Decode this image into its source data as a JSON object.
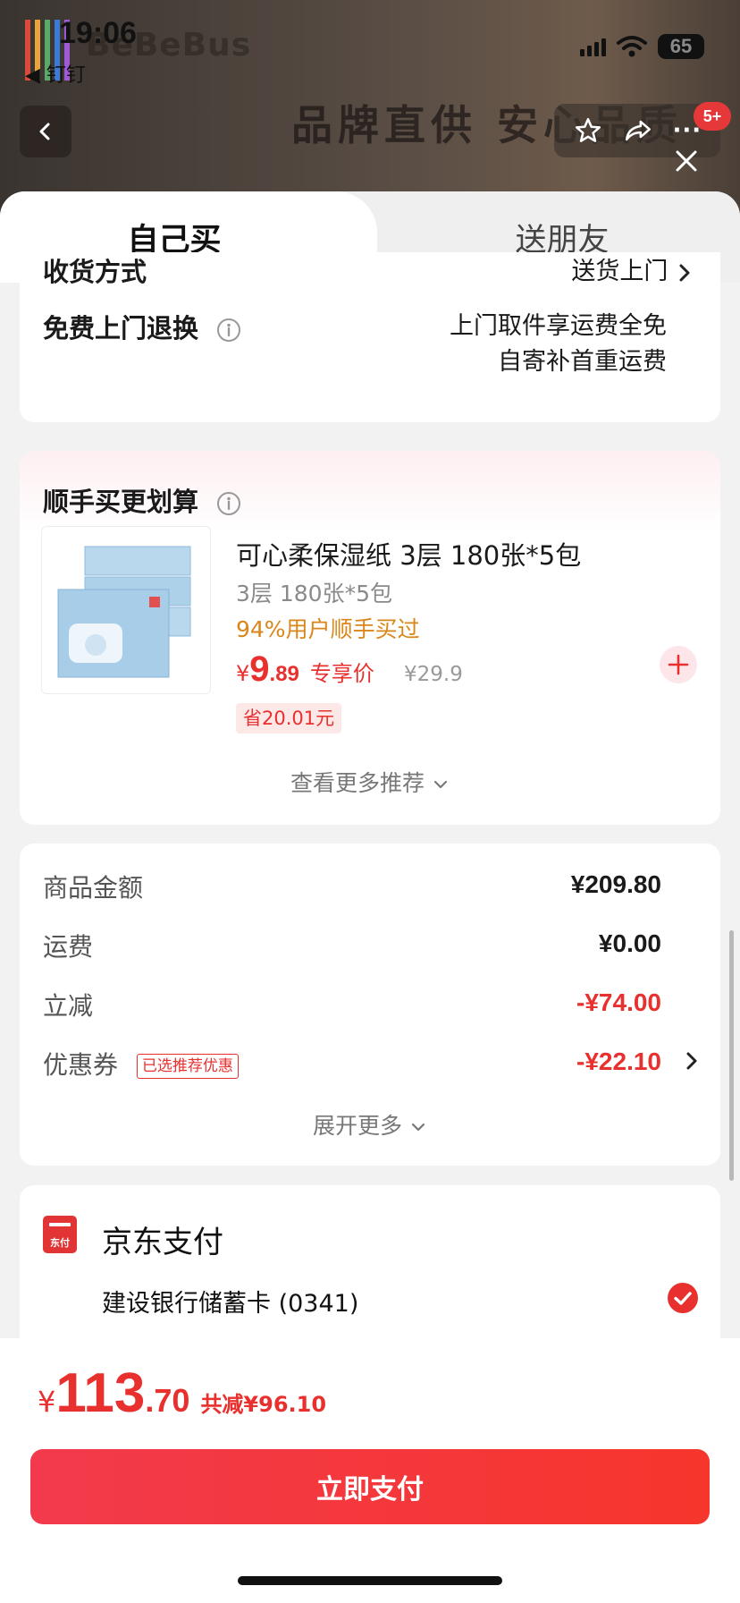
{
  "status_bar": {
    "time": "19:06",
    "back_app": "◀ 钉钉",
    "battery": "65"
  },
  "backdrop": {
    "brand": "BeBeBus",
    "slogan": "品牌直供 安心品质",
    "cart_badge": "5+"
  },
  "tabs": [
    {
      "label": "自己买"
    },
    {
      "label": "送朋友"
    }
  ],
  "delivery": {
    "method_label": "收货方式",
    "method_value": "送货上门",
    "return_label": "免费上门退换",
    "return_line1": "上门取件享运费全免",
    "return_line2": "自寄补首重运费"
  },
  "addon": {
    "title": "顺手买更划算",
    "product": {
      "name": "可心柔保湿纸 3层 180张*5包",
      "spec": "3层 180张*5包",
      "social": "94%用户顺手买过",
      "price_currency": "¥",
      "price_int": "9",
      "price_dec": ".89",
      "price_tag": "专享价",
      "original_price": "¥29.9",
      "saving": "省20.01元"
    },
    "see_more": "查看更多推荐"
  },
  "amounts": {
    "rows": [
      {
        "label": "商品金额",
        "value": "¥209.80"
      },
      {
        "label": "运费",
        "value": "¥0.00"
      },
      {
        "label": "立减",
        "value": "-¥74.00"
      },
      {
        "label": "优惠券",
        "value": "-¥22.10",
        "tag": "已选推荐优惠"
      }
    ],
    "expand": "展开更多"
  },
  "payment": {
    "logo_text": "东付",
    "name": "京东支付",
    "card": "建设银行储蓄卡 (0341)"
  },
  "total": {
    "currency": "¥",
    "int": "113",
    "dec": ".70",
    "discount": "共减¥96.10"
  },
  "pay_button": "立即支付",
  "colors": {
    "accent": "#e8302e",
    "social": "#d9861a",
    "button_start": "#f23a4c",
    "button_end": "#f6352c"
  },
  "icons": [
    "back-arrow-icon",
    "star-icon",
    "share-icon",
    "more-icon",
    "close-icon",
    "info-icon",
    "chevron-right-icon",
    "chevron-down-icon",
    "plus-icon",
    "jd-pay-logo",
    "check-icon"
  ]
}
